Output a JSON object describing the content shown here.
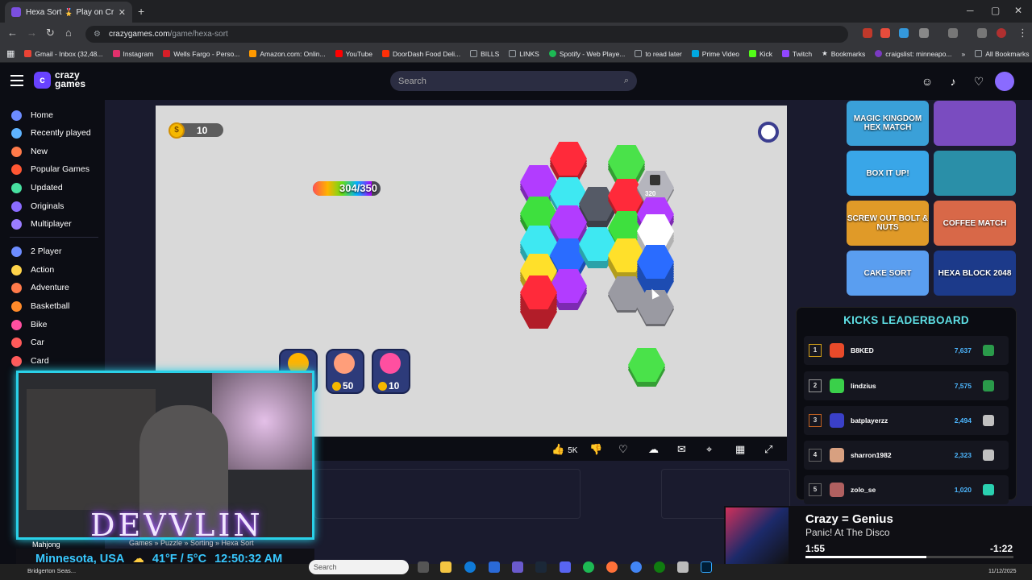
{
  "browser": {
    "tab_title": "Hexa Sort 🎖️ Play on CrazyGames",
    "url_domain": "crazygames.com",
    "url_path": "/game/hexa-sort",
    "bookmarks": [
      {
        "label": "Gmail - Inbox (32,48...",
        "color": "#ea4335"
      },
      {
        "label": "Instagram",
        "color": "#e1306c"
      },
      {
        "label": "Wells Fargo - Perso...",
        "color": "#d71e28"
      },
      {
        "label": "Amazon.com: Onlin...",
        "color": "#ff9900"
      },
      {
        "label": "YouTube",
        "color": "#ff0000"
      },
      {
        "label": "DoorDash Food Deli...",
        "color": "#ff3008"
      },
      {
        "label": "BILLS",
        "color": "#9aa0a6"
      },
      {
        "label": "LINKS",
        "color": "#9aa0a6"
      },
      {
        "label": "Spotify - Web Playe...",
        "color": "#1db954"
      },
      {
        "label": "to read later",
        "color": "#9aa0a6"
      },
      {
        "label": "Prime Video",
        "color": "#00a8e1"
      },
      {
        "label": "Kick",
        "color": "#53fc18"
      },
      {
        "label": "Twitch",
        "color": "#9146ff"
      },
      {
        "label": "Bookmarks",
        "color": "#9aa0a6"
      },
      {
        "label": "craigslist: minneapo...",
        "color": "#7a3ac2"
      }
    ],
    "all_bookmarks": "All Bookmarks"
  },
  "site": {
    "logo_text_1": "crazy",
    "logo_text_2": "games",
    "search_placeholder": "Search"
  },
  "sidebar": {
    "items": [
      {
        "label": "Home",
        "color": "#6d8cff"
      },
      {
        "label": "Recently played",
        "color": "#5fb3ff"
      },
      {
        "label": "New",
        "color": "#ff7a4a"
      },
      {
        "label": "Popular Games",
        "color": "#ff5733"
      },
      {
        "label": "Updated",
        "color": "#47e0a0"
      },
      {
        "label": "Originals",
        "color": "#8a6bff"
      },
      {
        "label": "Multiplayer",
        "color": "#9b7cff"
      }
    ],
    "categories": [
      {
        "label": "2 Player",
        "color": "#6d8cff"
      },
      {
        "label": "Action",
        "color": "#ffd34a"
      },
      {
        "label": "Adventure",
        "color": "#ff7a4a"
      },
      {
        "label": "Basketball",
        "color": "#ff8a2a"
      },
      {
        "label": "Bike",
        "color": "#ff4fa0"
      },
      {
        "label": "Car",
        "color": "#ff5a5a"
      },
      {
        "label": "Card",
        "color": "#ff5a5a"
      }
    ]
  },
  "game": {
    "coins": "10",
    "progress_text": "304/350",
    "progress_fraction": 0.8686,
    "lock_value": "320",
    "boosters": [
      {
        "name": "hammer",
        "price": "",
        "color": "#ffb300"
      },
      {
        "name": "hand",
        "price": "50",
        "color": "#ff9e7a"
      },
      {
        "name": "shuffle",
        "price": "10",
        "color": "#ff4fa0"
      }
    ]
  },
  "toolbar": {
    "likes": "5K"
  },
  "right_games": [
    {
      "label": "MAGIC KINGDOM HEX MATCH",
      "bg": "#3aa0d8"
    },
    {
      "label": "",
      "bg": "#7a4cc0"
    },
    {
      "label": "BOX IT UP!",
      "bg": "#39a6e8"
    },
    {
      "label": "",
      "bg": "#2a8fa8"
    },
    {
      "label": "SCREW OUT BOLT & NUTS",
      "bg": "#e09a28"
    },
    {
      "label": "COFFEE MATCH",
      "bg": "#d86848"
    },
    {
      "label": "CAKE SORT",
      "bg": "#5a9ef0"
    },
    {
      "label": "HEXA BLOCK 2048",
      "bg": "#1c3a8a"
    }
  ],
  "leaderboard": {
    "title": "KICKS LEADERBOARD",
    "rows": [
      {
        "rank": "1",
        "name": "B8KED",
        "points": "7,637",
        "avatar": "#e84a2a",
        "badge": "#2a9a4a"
      },
      {
        "rank": "2",
        "name": "lindzius",
        "points": "7,575",
        "avatar": "#3ad04a",
        "badge": "#2a9a4a"
      },
      {
        "rank": "3",
        "name": "batplayerzz",
        "points": "2,494",
        "avatar": "#3a40c8",
        "badge": "#c0c0c0"
      },
      {
        "rank": "4",
        "name": "sharron1982",
        "points": "2,323",
        "avatar": "#d8a080",
        "badge": "#c0c0c0"
      },
      {
        "rank": "5",
        "name": "zolo_se",
        "points": "1,020",
        "avatar": "#b06060",
        "badge": "#2ad0b0"
      }
    ]
  },
  "stream": {
    "brand": "DEVVLIN",
    "location": "Minnesota, USA",
    "weather": "41°F / 5°C",
    "time": "12:50:32 AM",
    "breadcrumbs": "Games » Puzzle » Sorting » Hexa Sort",
    "sidebar_partial": "Mahjong"
  },
  "music": {
    "title": "Crazy = Genius",
    "artist": "Panic! At The Disco",
    "elapsed": "1:55",
    "remaining": "-1:22",
    "progress_fraction": 0.58
  },
  "taskbar": {
    "search_placeholder": "Search",
    "left_label": "Bridgerton Seas...",
    "date": "11/12/2025"
  }
}
